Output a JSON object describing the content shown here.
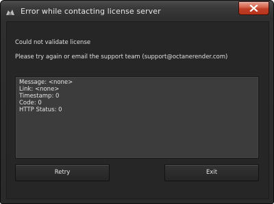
{
  "window": {
    "title": "Error while contacting license server"
  },
  "message": {
    "line1": "Could not validate license",
    "line2": "Please try again or email the support team (support@octanerender.com)"
  },
  "details": {
    "message": "Message: <none>",
    "link": "Link: <none>",
    "timestamp": "Timestamp: 0",
    "code": "Code: 0",
    "http_status": "HTTP Status: 0"
  },
  "buttons": {
    "retry": "Retry",
    "exit": "Exit"
  },
  "icons": {
    "app": "octane-app-icon",
    "close": "close-icon"
  },
  "colors": {
    "close_button": "#c7432c",
    "background": "#2a2a2a",
    "details_box": "#3c3c3c"
  }
}
